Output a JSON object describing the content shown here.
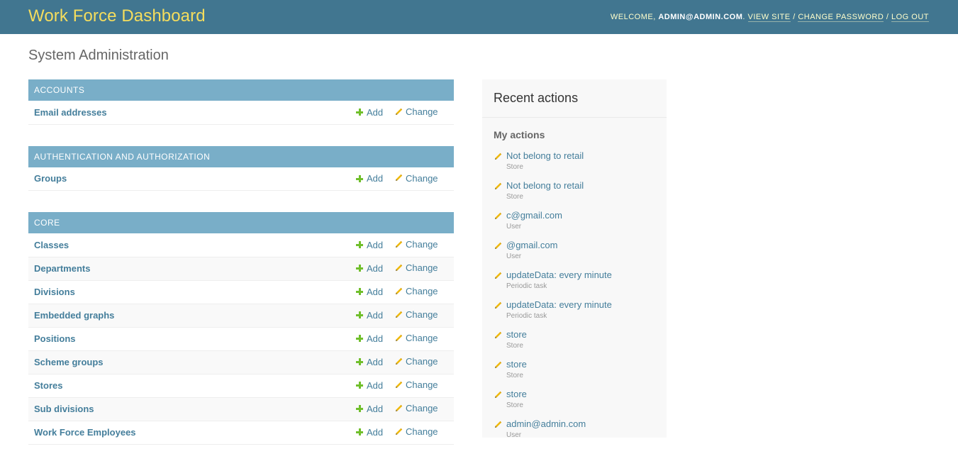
{
  "header": {
    "brand": "Work Force Dashboard",
    "welcome": "WELCOME,",
    "user": "ADMIN@ADMIN.COM",
    "view_site": "VIEW SITE",
    "change_password": "CHANGE PASSWORD",
    "log_out": "LOG OUT",
    "separator": "/"
  },
  "page_title": "System Administration",
  "links": {
    "add": "Add",
    "change": "Change"
  },
  "modules": [
    {
      "caption": "ACCOUNTS",
      "models": [
        "Email addresses"
      ]
    },
    {
      "caption": "AUTHENTICATION AND AUTHORIZATION",
      "models": [
        "Groups"
      ]
    },
    {
      "caption": "CORE",
      "models": [
        "Classes",
        "Departments",
        "Divisions",
        "Embedded graphs",
        "Positions",
        "Scheme groups",
        "Stores",
        "Sub divisions",
        "Work Force Employees"
      ]
    }
  ],
  "recent_actions": {
    "title": "Recent actions",
    "subtitle": "My actions",
    "items": [
      {
        "label": "Not belong to retail",
        "type": "Store"
      },
      {
        "label": "Not belong to retail",
        "type": "Store"
      },
      {
        "label": "c@gmail.com",
        "type": "User"
      },
      {
        "label": "@gmail.com",
        "type": "User"
      },
      {
        "label": "updateData: every minute",
        "type": "Periodic task"
      },
      {
        "label": "updateData: every minute",
        "type": "Periodic task"
      },
      {
        "label": "store",
        "type": "Store"
      },
      {
        "label": "store",
        "type": "Store"
      },
      {
        "label": "store",
        "type": "Store"
      },
      {
        "label": "admin@admin.com",
        "type": "User"
      }
    ]
  },
  "colors": {
    "header_bg": "#417690",
    "brand": "#f5dd5d",
    "caption_bg": "#79aec8",
    "link": "#447e9b",
    "add_green": "#70bf2b",
    "pencil_yellow": "#efb80b"
  }
}
